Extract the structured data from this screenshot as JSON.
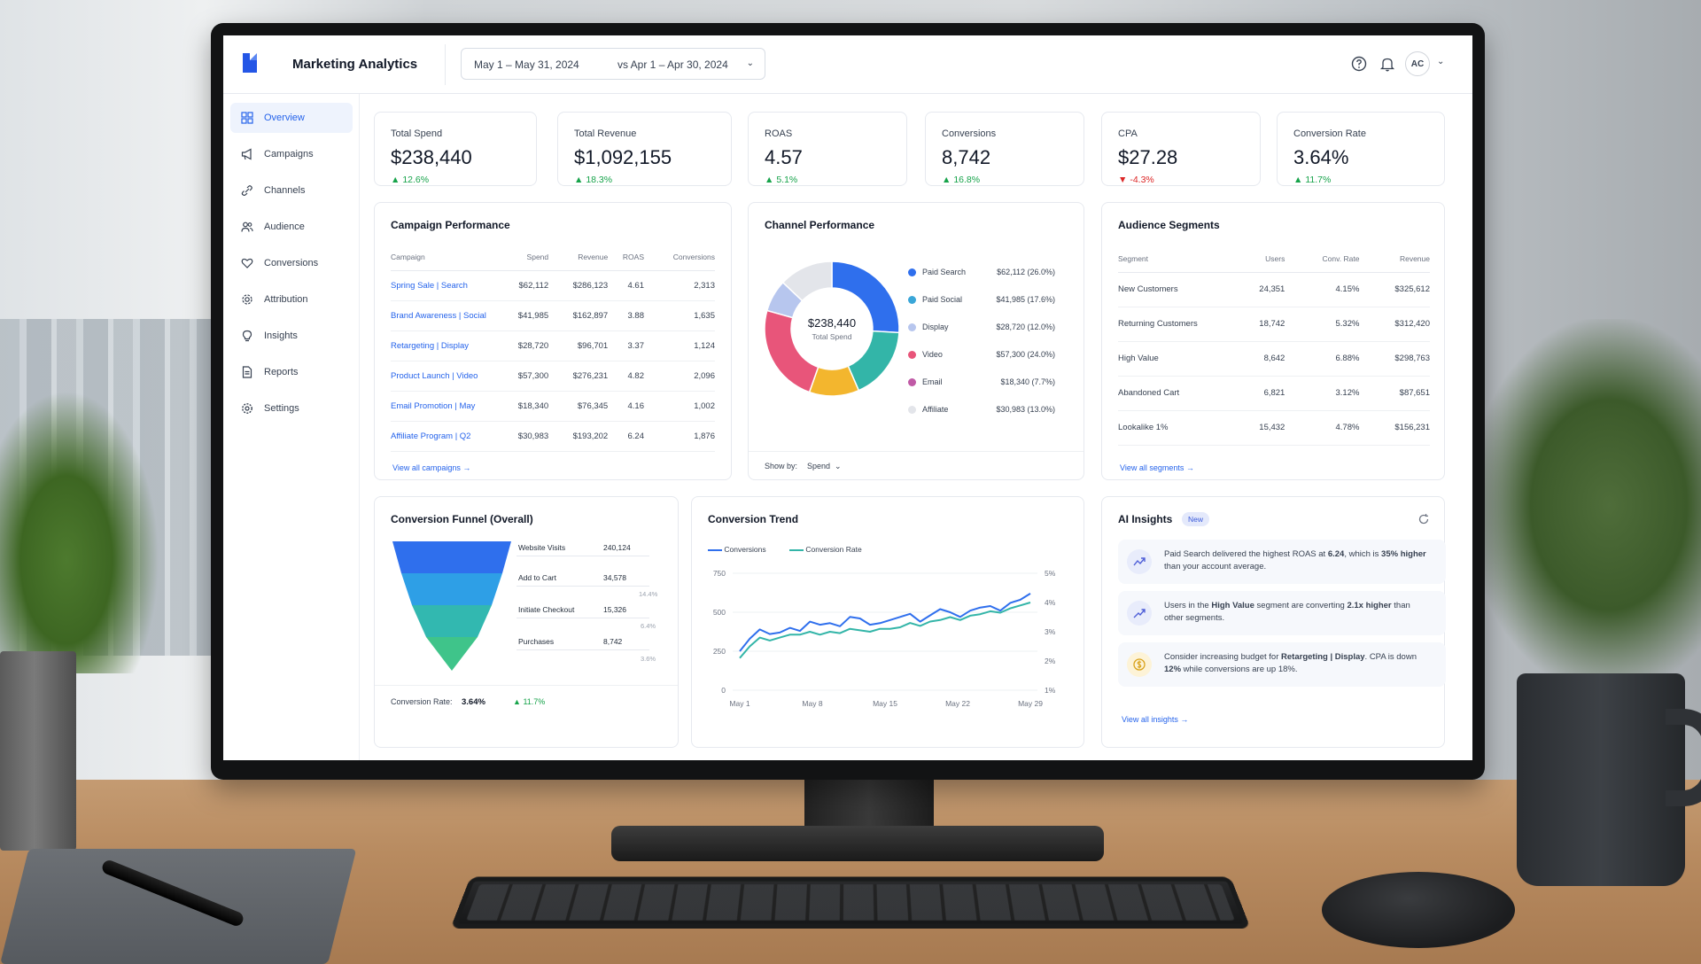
{
  "app": {
    "title": "Marketing Analytics"
  },
  "date_range": {
    "current": "May 1 – May 31, 2024",
    "compare": "vs  Apr 1 – Apr 30, 2024"
  },
  "user": {
    "initials": "AC"
  },
  "colors": {
    "accent": "#2563eb",
    "up": "#16a34a",
    "down": "#dc2626"
  },
  "sidebar": {
    "items": [
      {
        "label": "Overview",
        "icon": "grid-icon",
        "active": true
      },
      {
        "label": "Campaigns",
        "icon": "megaphone-icon"
      },
      {
        "label": "Channels",
        "icon": "link-icon"
      },
      {
        "label": "Audience",
        "icon": "users-icon"
      },
      {
        "label": "Conversions",
        "icon": "heart-icon"
      },
      {
        "label": "Attribution",
        "icon": "gear-network-icon"
      },
      {
        "label": "Insights",
        "icon": "lightbulb-icon"
      },
      {
        "label": "Reports",
        "icon": "document-icon"
      },
      {
        "label": "Settings",
        "icon": "gear-icon"
      }
    ]
  },
  "kpis": [
    {
      "label": "Total Spend",
      "value": "$238,440",
      "delta": "12.6%",
      "direction": "up"
    },
    {
      "label": "Total Revenue",
      "value": "$1,092,155",
      "delta": "18.3%",
      "direction": "up"
    },
    {
      "label": "ROAS",
      "value": "4.57",
      "delta": "5.1%",
      "direction": "up"
    },
    {
      "label": "Conversions",
      "value": "8,742",
      "delta": "16.8%",
      "direction": "up"
    },
    {
      "label": "CPA",
      "value": "$27.28",
      "delta": "-4.3%",
      "direction": "down"
    },
    {
      "label": "Conversion Rate",
      "value": "3.64%",
      "delta": "11.7%",
      "direction": "up"
    }
  ],
  "campaigns": {
    "title": "Campaign Performance",
    "headers": [
      "Campaign",
      "Spend",
      "Revenue",
      "ROAS",
      "Conversions"
    ],
    "rows": [
      [
        "Spring Sale | Search",
        "$62,112",
        "$286,123",
        "4.61",
        "2,313"
      ],
      [
        "Brand Awareness | Social",
        "$41,985",
        "$162,897",
        "3.88",
        "1,635"
      ],
      [
        "Retargeting | Display",
        "$28,720",
        "$96,701",
        "3.37",
        "1,124"
      ],
      [
        "Product Launch | Video",
        "$57,300",
        "$276,231",
        "4.82",
        "2,096"
      ],
      [
        "Email Promotion | May",
        "$18,340",
        "$76,345",
        "4.16",
        "1,002"
      ],
      [
        "Affiliate Program | Q2",
        "$30,983",
        "$193,202",
        "6.24",
        "1,876"
      ]
    ],
    "view_all": "View all campaigns"
  },
  "channels": {
    "title": "Channel Performance",
    "center_value": "$238,440",
    "center_label": "Total Spend",
    "show_by_label": "Show by:",
    "show_by_value": "Spend",
    "items": [
      {
        "name": "Paid Search",
        "value": "$62,112 (26.0%)",
        "share": 26.0,
        "color": "#2f6fed"
      },
      {
        "name": "Paid Social",
        "value": "$41,985 (17.6%)",
        "share": 17.6,
        "color": "#3aa6d8"
      },
      {
        "name": "Display",
        "value": "$28,720 (12.0%)",
        "share": 12.0,
        "color": "#b7c6ee"
      },
      {
        "name": "Video",
        "value": "$57,300 (24.0%)",
        "share": 24.0,
        "color": "#e8557a"
      },
      {
        "name": "Email",
        "value": "$18,340 (7.7%)",
        "share": 7.7,
        "color": "#c05aa6"
      },
      {
        "name": "Affiliate",
        "value": "$30,983 (13.0%)",
        "share": 13.0,
        "color": "#e3e5ea"
      }
    ],
    "ring_order": [
      {
        "share": 26.0,
        "color": "#2f6fed"
      },
      {
        "share": 17.6,
        "color": "#33b5a8"
      },
      {
        "share": 12.0,
        "color": "#f3b62e"
      },
      {
        "share": 24.0,
        "color": "#e8557a"
      },
      {
        "share": 7.7,
        "color": "#b7c6ee"
      },
      {
        "share": 13.0,
        "color": "#e3e5ea"
      }
    ]
  },
  "segments": {
    "title": "Audience Segments",
    "headers": [
      "Segment",
      "Users",
      "Conv. Rate",
      "Revenue"
    ],
    "rows": [
      [
        "New Customers",
        "24,351",
        "4.15%",
        "$325,612"
      ],
      [
        "Returning Customers",
        "18,742",
        "5.32%",
        "$312,420"
      ],
      [
        "High Value",
        "8,642",
        "6.88%",
        "$298,763"
      ],
      [
        "Abandoned Cart",
        "6,821",
        "3.12%",
        "$87,651"
      ],
      [
        "Lookalike 1%",
        "15,432",
        "4.78%",
        "$156,231"
      ]
    ],
    "view_all": "View all segments"
  },
  "funnel": {
    "title": "Conversion Funnel (Overall)",
    "stages": [
      {
        "name": "Website Visits",
        "value": "240,124",
        "color": "#2f6fed"
      },
      {
        "name": "Add to Cart",
        "value": "34,578",
        "color": "#2e9fe6"
      },
      {
        "name": "Initiate Checkout",
        "value": "15,326",
        "color": "#32b8b0"
      },
      {
        "name": "Purchases",
        "value": "8,742",
        "color": "#3fc48a"
      }
    ],
    "rates": [
      "14.4%",
      "6.4%",
      "3.6%"
    ],
    "footer_label": "Conversion Rate:",
    "footer_value": "3.64%",
    "footer_delta": "11.7%"
  },
  "trend": {
    "title": "Conversion Trend",
    "chart_data": {
      "type": "line",
      "x_labels": [
        "May 1",
        "May 8",
        "May 15",
        "May 22",
        "May 29"
      ],
      "y_left_ticks": [
        "750",
        "500",
        "250",
        "0"
      ],
      "y_right_ticks": [
        "5%",
        "4%",
        "3%",
        "2%",
        "1%"
      ],
      "ylim_left": [
        0,
        750
      ],
      "ylim_right": [
        1,
        5
      ],
      "series": [
        {
          "name": "Conversions",
          "axis": "left",
          "color": "#2f6fed",
          "values": [
            250,
            330,
            390,
            360,
            370,
            400,
            380,
            440,
            420,
            430,
            410,
            470,
            460,
            420,
            430,
            450,
            470,
            490,
            440,
            480,
            520,
            500,
            470,
            510,
            530,
            540,
            510,
            560,
            580,
            620
          ]
        },
        {
          "name": "Conversion Rate",
          "axis": "right",
          "color": "#33b5a8",
          "values": [
            2.1,
            2.5,
            2.8,
            2.7,
            2.8,
            2.9,
            2.9,
            3.0,
            2.9,
            3.0,
            2.95,
            3.1,
            3.05,
            3.0,
            3.1,
            3.1,
            3.15,
            3.3,
            3.2,
            3.35,
            3.4,
            3.5,
            3.4,
            3.55,
            3.6,
            3.7,
            3.65,
            3.8,
            3.9,
            4.0
          ]
        }
      ]
    }
  },
  "insights": {
    "title": "AI Insights",
    "badge": "New",
    "items": [
      {
        "pre": "Paid Search delivered the highest ROAS at ",
        "b1": "6.24",
        "mid": ", which is ",
        "b2": "35% higher",
        "post": " than your account average.",
        "icon": "trend-up-icon"
      },
      {
        "pre": "Users in the ",
        "b1": "High Value",
        "mid": " segment are converting ",
        "b2": "2.1x higher",
        "post": " than other segments.",
        "icon": "chart-up-icon"
      },
      {
        "pre": "Consider increasing budget for ",
        "b1": "Retargeting | Display",
        "mid": ". CPA is down ",
        "b2": "12%",
        "post": " while conversions are up 18%.",
        "icon": "dollar-icon"
      }
    ],
    "view_all": "View all insights"
  }
}
